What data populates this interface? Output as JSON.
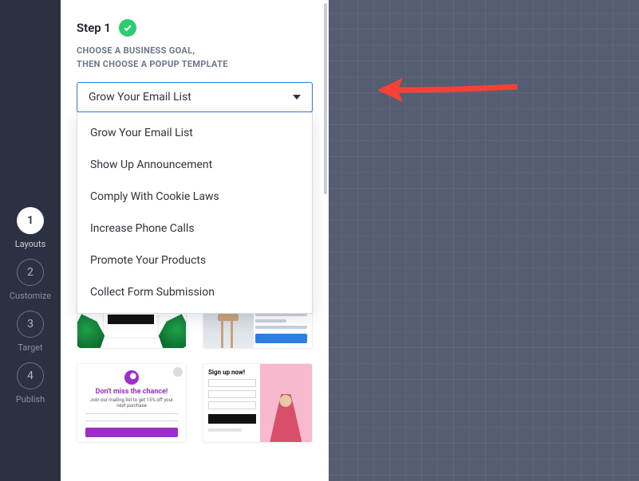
{
  "nav": {
    "items": [
      {
        "num": "1",
        "label": "Layouts",
        "active": true
      },
      {
        "num": "2",
        "label": "Customize",
        "active": false
      },
      {
        "num": "3",
        "label": "Target",
        "active": false
      },
      {
        "num": "4",
        "label": "Publish",
        "active": false
      }
    ]
  },
  "step": {
    "title": "Step 1",
    "subtitle_line1": "CHOOSE A BUSINESS GOAL,",
    "subtitle_line2": "THEN CHOOSE A POPUP TEMPLATE"
  },
  "goal_select": {
    "selected": "Grow Your Email List",
    "options": [
      "Grow Your Email List",
      "Show Up Announcement",
      "Comply With Cookie Laws",
      "Increase Phone Calls",
      "Promote Your Products",
      "Collect Form Submission"
    ]
  },
  "templates": {
    "tpl3_headline": "Don't miss the chance!",
    "tpl3_sub": "Join our mailing list to get 15% off your next purchase",
    "tpl4_title": "Sign up now!"
  },
  "arrow": {
    "color": "#f44336"
  }
}
